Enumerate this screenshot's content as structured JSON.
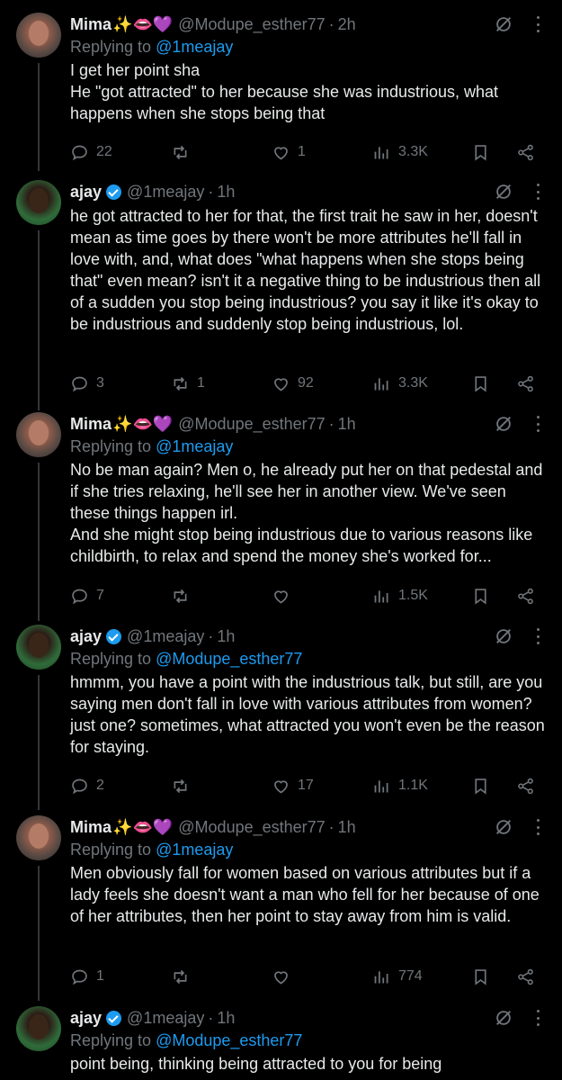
{
  "tweets": [
    {
      "name": "Mima",
      "verified": false,
      "handle": "@Modupe_esther77",
      "time": "2h",
      "replying_prefix": "Replying to ",
      "replying_handle": "@1meajay",
      "text": "I get her point sha\nHe \"got attracted\" to her because she was industrious, what happens when she stops being that",
      "stats": {
        "replies": "22",
        "reposts": "",
        "likes": "1",
        "views": "3.3K"
      }
    },
    {
      "name": "ajay",
      "verified": true,
      "handle": "@1meajay",
      "time": "1h",
      "replying_prefix": "",
      "replying_handle": "",
      "text": "he got attracted to her for that, the first trait he saw in her, doesn't mean as time goes by there won't be more attributes he'll fall in love with, and, what does \"what happens when she stops being that\" even mean? isn't it a negative thing to be industrious then all of a sudden you stop being industrious? you say it like it's okay to be industrious and suddenly stop being industrious, lol.",
      "stats": {
        "replies": "3",
        "reposts": "1",
        "likes": "92",
        "views": "3.3K"
      }
    },
    {
      "name": "Mima",
      "verified": false,
      "handle": "@Modupe_esther77",
      "time": "1h",
      "replying_prefix": "Replying to ",
      "replying_handle": "@1meajay",
      "text": "No be man again? Men o, he already put her on that pedestal and if she tries relaxing, he'll see her in another view. We've seen these things happen irl.\nAnd she might stop being industrious due to various reasons like childbirth, to relax and spend the money she's worked for...",
      "stats": {
        "replies": "7",
        "reposts": "",
        "likes": "",
        "views": "1.5K"
      }
    },
    {
      "name": "ajay",
      "verified": true,
      "handle": "@1meajay",
      "time": "1h",
      "replying_prefix": "Replying to ",
      "replying_handle": "@Modupe_esther77",
      "text": "hmmm, you have a point with the industrious talk, but still, are you saying men don't fall in love with various attributes from women? just one? sometimes, what attracted you won't even be the reason for staying.",
      "stats": {
        "replies": "2",
        "reposts": "",
        "likes": "17",
        "views": "1.1K"
      }
    },
    {
      "name": "Mima",
      "verified": false,
      "handle": "@Modupe_esther77",
      "time": "1h",
      "replying_prefix": "Replying to ",
      "replying_handle": "@1meajay",
      "text": "Men obviously fall for women based on various attributes but if a lady feels she doesn't want a man who fell for her because of one of her attributes, then her point to stay away from him is valid.",
      "stats": {
        "replies": "1",
        "reposts": "",
        "likes": "",
        "views": "774"
      }
    },
    {
      "name": "ajay",
      "verified": true,
      "handle": "@1meajay",
      "time": "1h",
      "replying_prefix": "Replying to ",
      "replying_handle": "@Modupe_esther77",
      "text": "point being, thinking being attracted to you for being",
      "stats": {
        "replies": "",
        "reposts": "",
        "likes": "",
        "views": ""
      }
    }
  ],
  "emoji": {
    "sparkles": "✨",
    "lips": "👄",
    "heart": "💜"
  },
  "icon_color": "#71767b",
  "link_color": "#1d9bf0"
}
